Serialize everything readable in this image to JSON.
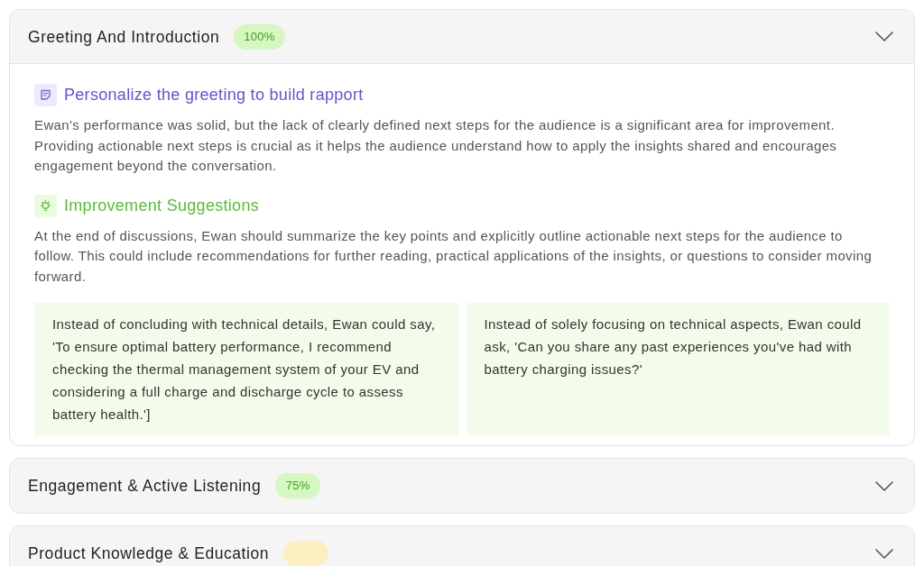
{
  "sections": [
    {
      "title": "Greeting And Introduction",
      "badge": {
        "text": "100%",
        "color": "#d6f6c2"
      },
      "expanded": true,
      "blocks": [
        {
          "kind": "feedback",
          "heading": "Personalize the greeting to build rapport",
          "text": "Ewan's performance was solid, but the lack of clearly defined next steps for the audience is a significant area for improvement. Providing actionable next steps is crucial as it helps the audience understand how to apply the insights shared and encourages engagement beyond the conversation."
        },
        {
          "kind": "suggestion",
          "heading": "Improvement Suggestions",
          "text": "At the end of discussions, Ewan  should summarize the key points and explicitly outline actionable next steps for the audience to follow. This could include recommendations for further reading, practical applications of the insights, or questions to consider moving forward."
        }
      ],
      "examples": [
        "Instead of concluding with technical details, Ewan could say, 'To ensure optimal battery performance, I recommend checking the thermal management system of your EV and considering a full charge and discharge cycle to assess battery health.']",
        "Instead of solely focusing on technical aspects, Ewan could ask, 'Can you share any past experiences you've had with battery charging issues?'"
      ]
    },
    {
      "title": "Engagement & Active Listening",
      "badge": {
        "text": "75%",
        "color": "#d6f6c2"
      },
      "expanded": false
    },
    {
      "title": "Product Knowledge & Education",
      "badge": {
        "color": "#fcefc0"
      },
      "expanded": false
    }
  ]
}
